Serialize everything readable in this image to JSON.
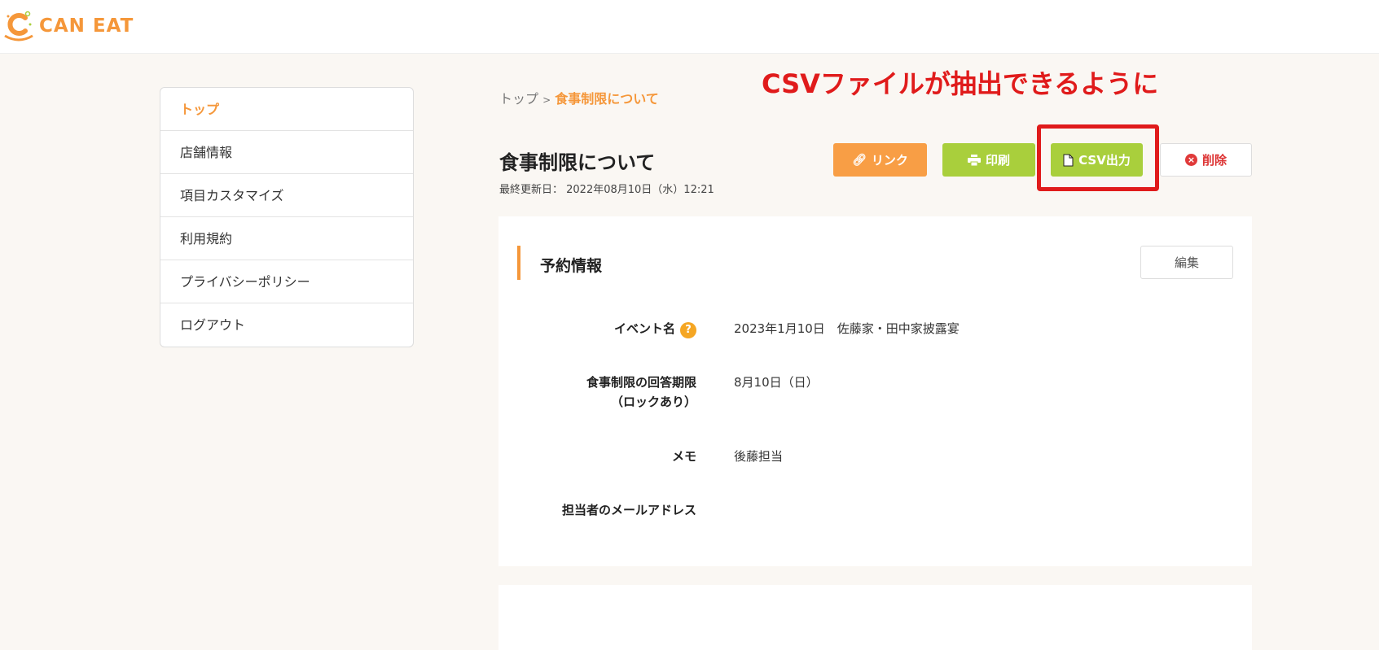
{
  "header": {
    "logo_text": "CAN EAT"
  },
  "sidebar": {
    "items": [
      {
        "label": "トップ"
      },
      {
        "label": "店舗情報"
      },
      {
        "label": "項目カスタマイズ"
      },
      {
        "label": "利用規約"
      },
      {
        "label": "プライバシーポリシー"
      },
      {
        "label": "ログアウト"
      }
    ]
  },
  "breadcrumb": {
    "home": "トップ",
    "sep": ">",
    "current": "食事制限について"
  },
  "annotation": "CSVファイルが抽出できるように",
  "page": {
    "title": "食事制限について",
    "updated": "最終更新日： 2022年08月10日（水）12:21"
  },
  "actions": {
    "link": "リンク",
    "print": "印刷",
    "csv": "CSV出力",
    "delete": "削除"
  },
  "section": {
    "title": "予約情報",
    "edit": "編集",
    "rows": [
      {
        "label": "イベント名",
        "value": "2023年1月10日　佐藤家・田中家披露宴"
      },
      {
        "label": "食事制限の回答期限",
        "label2": "（ロックあり）",
        "value": "8月10日（日）"
      },
      {
        "label": "メモ",
        "value": "後藤担当"
      },
      {
        "label": "担当者のメールアドレス",
        "value": ""
      }
    ]
  },
  "colors": {
    "accent": "#f5973a",
    "green": "#a9cf3c",
    "red": "#e01b1b"
  }
}
